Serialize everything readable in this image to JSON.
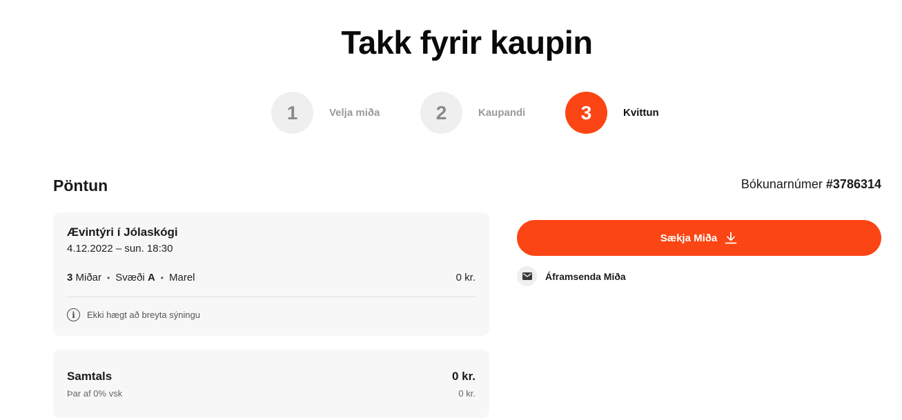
{
  "page": {
    "title": "Takk fyrir kaupin"
  },
  "steps": [
    {
      "number": "1",
      "label": "Velja miða",
      "state": "done"
    },
    {
      "number": "2",
      "label": "Kaupandi",
      "state": "done"
    },
    {
      "number": "3",
      "label": "Kvittun",
      "state": "active"
    }
  ],
  "order": {
    "section_title": "Pöntun",
    "booking_label": "Bókunarnúmer",
    "booking_number": "#3786314",
    "event_name": "Ævintýri í Jólaskógi",
    "event_date": "4.12.2022 – sun. 18:30",
    "ticket_count": "3",
    "ticket_label": "Miðar",
    "zone_label": "Svæði",
    "zone_value": "A",
    "venue": "Marel",
    "ticket_price": "0 kr.",
    "notice": "Ekki hægt að breyta sýningu"
  },
  "totals": {
    "label": "Samtals",
    "value": "0 kr.",
    "vat_label": "Þar af 0% vsk",
    "vat_value": "0 kr."
  },
  "actions": {
    "download_label": "Sækja Miða",
    "forward_label": "Áframsenda Miða"
  },
  "colors": {
    "accent": "#fb4514",
    "card_bg": "#f7f7f7",
    "inactive_circle": "#efefef"
  },
  "icons": {
    "download": "download-icon",
    "mail": "mail-icon",
    "info": "info-icon"
  }
}
